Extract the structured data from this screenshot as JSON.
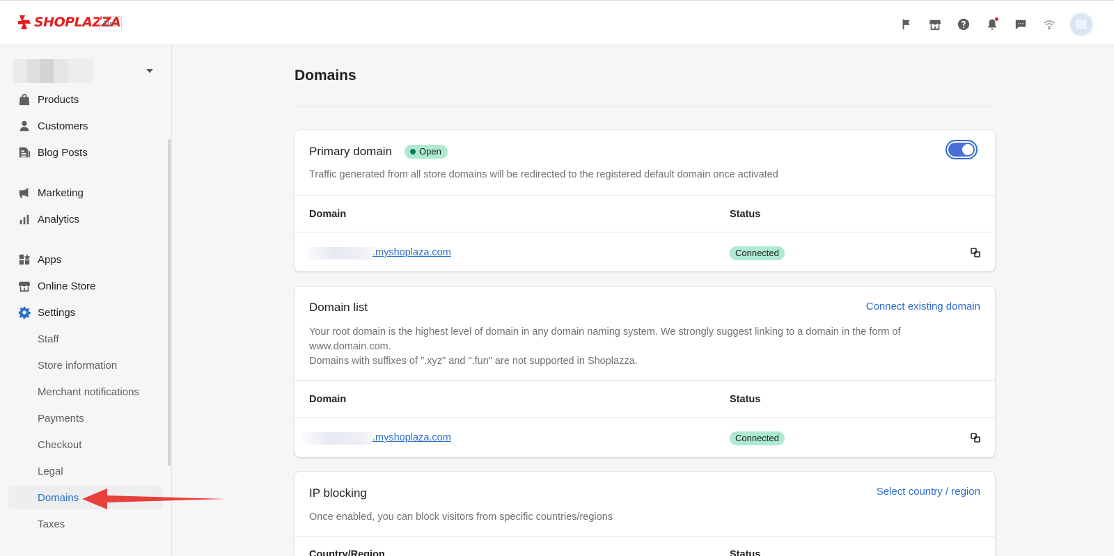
{
  "brand": {
    "name": "SHOPLAZZA",
    "plan": "Pro",
    "color": "#e61e1e"
  },
  "topbar": {
    "icons": [
      "flag-icon",
      "store-icon",
      "help-icon",
      "bell-icon",
      "chat-icon",
      "wifi-icon"
    ],
    "avatar": "avatar"
  },
  "sidebar": {
    "items": [
      {
        "label": "Products",
        "icon": "products-icon"
      },
      {
        "label": "Customers",
        "icon": "customers-icon"
      },
      {
        "label": "Blog Posts",
        "icon": "blog-icon"
      },
      {
        "label": "Marketing",
        "icon": "megaphone-icon"
      },
      {
        "label": "Analytics",
        "icon": "analytics-icon"
      },
      {
        "label": "Apps",
        "icon": "apps-icon"
      },
      {
        "label": "Online Store",
        "icon": "store-icon"
      },
      {
        "label": "Settings",
        "icon": "gear-icon"
      }
    ],
    "settings_sub": [
      {
        "label": "Staff"
      },
      {
        "label": "Store information"
      },
      {
        "label": "Merchant notifications"
      },
      {
        "label": "Payments"
      },
      {
        "label": "Checkout"
      },
      {
        "label": "Legal"
      },
      {
        "label": "Domains",
        "active": true
      },
      {
        "label": "Taxes"
      }
    ]
  },
  "main": {
    "title": "Domains",
    "primary": {
      "title": "Primary domain",
      "badge": "Open",
      "toggle_on": true,
      "desc": "Traffic generated from all store domains will be redirected to the registered default domain once activated",
      "col_domain": "Domain",
      "col_status": "Status",
      "domain": ".myshoplaza.com",
      "status": "Connected"
    },
    "domain_list": {
      "title": "Domain list",
      "action": "Connect existing domain",
      "desc_1": "Your root domain is the highest level of domain in any domain naming system. We strongly suggest linking to a domain in the form of www.domain.com.",
      "desc_2": "Domains with suffixes of \".xyz\" and \".fun\" are not supported in Shoplazza.",
      "col_domain": "Domain",
      "col_status": "Status",
      "domain": ".myshoplaza.com",
      "status": "Connected"
    },
    "ip_blocking": {
      "title": "IP blocking",
      "action": "Select country / region",
      "desc": "Once enabled, you can block visitors from specific countries/regions",
      "col_country": "Country/Region",
      "col_status": "Status"
    }
  },
  "colors": {
    "accent": "#2c6ecb",
    "success_bg": "#aee9d1",
    "arrow": "#e8413b"
  }
}
